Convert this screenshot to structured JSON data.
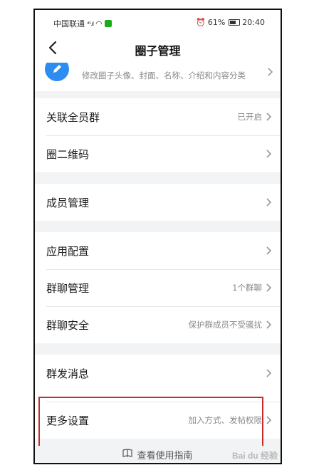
{
  "status_bar": {
    "carrier": "中国联通",
    "signal": "⁴ᴳ.ıl",
    "battery": "61%",
    "time": "20:40"
  },
  "nav": {
    "title": "圈子管理"
  },
  "profile": {
    "description": "修改圈子头像、封面、名称、介绍和内容分类"
  },
  "sections": [
    {
      "rows": [
        {
          "label": "关联全员群",
          "value": "已开启"
        },
        {
          "label": "圈二维码",
          "value": ""
        }
      ]
    },
    {
      "rows": [
        {
          "label": "成员管理",
          "value": ""
        }
      ]
    },
    {
      "rows": [
        {
          "label": "应用配置",
          "value": ""
        },
        {
          "label": "群聊管理",
          "value": "1个群聊"
        },
        {
          "label": "群聊安全",
          "value": "保护群成员不受骚扰"
        }
      ]
    },
    {
      "rows": [
        {
          "label": "群发消息",
          "value": ""
        },
        {
          "label": "更多设置",
          "value": "加入方式、发帖权限"
        }
      ]
    }
  ],
  "footer": {
    "guide": "查看使用指南"
  },
  "watermark": "Bai du 经验"
}
